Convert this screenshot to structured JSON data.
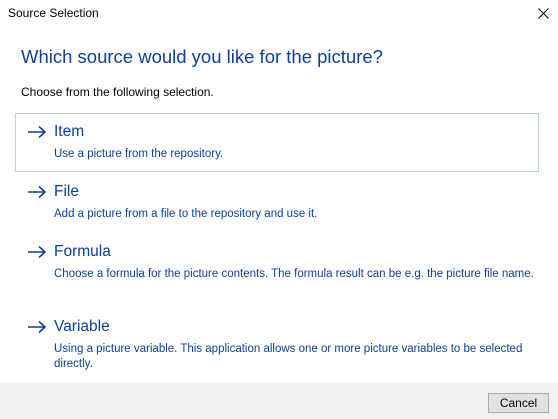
{
  "window": {
    "title": "Source Selection"
  },
  "heading": "Which source would you like for the picture?",
  "subheading": "Choose from the following selection.",
  "options": [
    {
      "title": "Item",
      "description": "Use a picture from the repository."
    },
    {
      "title": "File",
      "description": "Add a picture from a file to the repository and use it."
    },
    {
      "title": "Formula",
      "description": "Choose a formula for the picture contents. The formula result can be e.g. the picture file name."
    },
    {
      "title": "Variable",
      "description": "Using a picture variable. This application allows one or more picture variables to be selected directly."
    }
  ],
  "footer": {
    "cancel_label": "Cancel"
  },
  "colors": {
    "accent": "#0e3f9e",
    "selected_border": "#b7d2ea",
    "footer_bg": "#f0f0f0"
  },
  "icons": {
    "option_arrow": "arrow-right-icon",
    "close": "close-icon"
  }
}
